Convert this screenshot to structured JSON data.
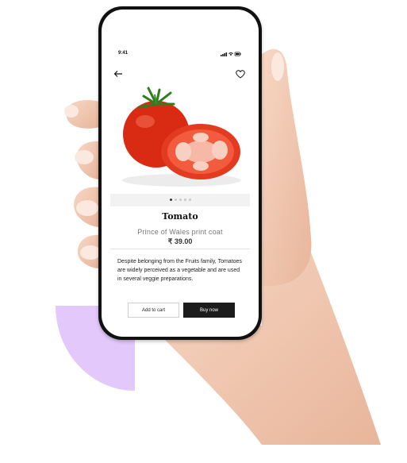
{
  "status": {
    "time": "9:41"
  },
  "nav": {
    "back_icon": "back-arrow-icon",
    "favorite_icon": "heart-icon"
  },
  "product": {
    "name": "Tomato",
    "subtitle": "Prince of Wales print coat",
    "price": "₹ 39.00",
    "description": "Despite belonging from the Fruits family, Tomatoes are widely perceived as a vegetable and are used in several veggie preparations."
  },
  "carousel": {
    "total": 5,
    "active_index": 0
  },
  "actions": {
    "add_to_cart": "Add to cart",
    "buy_now": "Buy now"
  },
  "colors": {
    "accent_purple": "#e3c9fb",
    "buy_button": "#1c1c1c",
    "tomato_red": "#e33b1f"
  }
}
